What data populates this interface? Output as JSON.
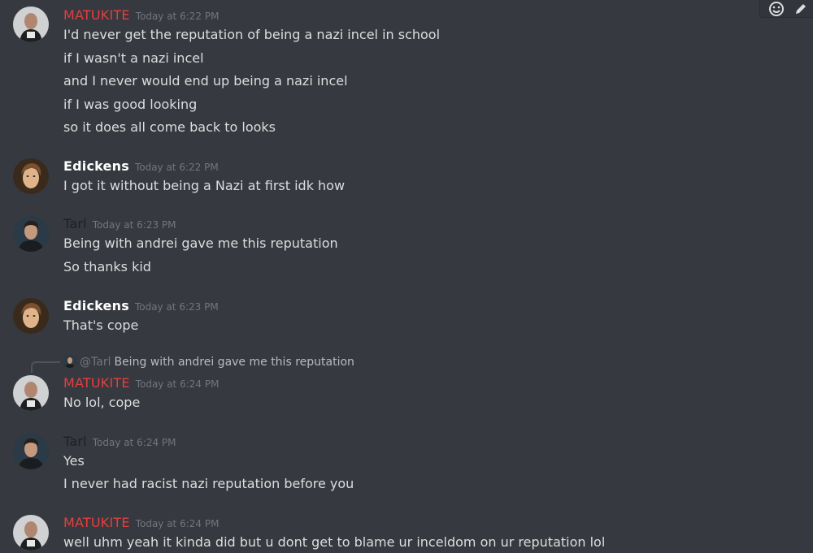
{
  "colors": {
    "background": "#36393f",
    "matukite_name": "#e43f3f",
    "edickens_name": "#ffffff",
    "tarl_name": "#1f1f1f",
    "timestamp": "#72767d",
    "message_text": "#dcddde"
  },
  "toolbar": {
    "icons": [
      "add-reaction-icon",
      "edit-icon"
    ]
  },
  "messages": [
    {
      "author": "MATUKITE",
      "timestamp": "Today at 6:22 PM",
      "lines": [
        "I'd never get the reputation of being a nazi incel in school",
        "if I wasn't a nazi incel",
        "and I never would end up being a nazi incel",
        "if I was good looking",
        "so it does all come back to looks"
      ]
    },
    {
      "author": "Edickens",
      "timestamp": "Today at 6:22 PM",
      "lines": [
        "I got it without being a Nazi at first idk how"
      ]
    },
    {
      "author": "Tarl",
      "timestamp": "Today at 6:23 PM",
      "lines": [
        "Being with andrei gave me this reputation",
        "So thanks kid"
      ]
    },
    {
      "author": "Edickens",
      "timestamp": "Today at 6:23 PM",
      "lines": [
        "That's cope"
      ]
    },
    {
      "author": "MATUKITE",
      "timestamp": "Today at 6:24 PM",
      "reply": {
        "mention": "@Tarl",
        "text": "Being with andrei gave me this reputation"
      },
      "lines": [
        "No lol, cope"
      ]
    },
    {
      "author": "Tarl",
      "timestamp": "Today at 6:24 PM",
      "lines": [
        "Yes",
        "I never had racist nazi reputation before you"
      ]
    },
    {
      "author": "MATUKITE",
      "timestamp": "Today at 6:24 PM",
      "lines": [
        "well uhm yeah it kinda did but u dont get to blame ur inceldom on ur reputation lol"
      ]
    }
  ]
}
